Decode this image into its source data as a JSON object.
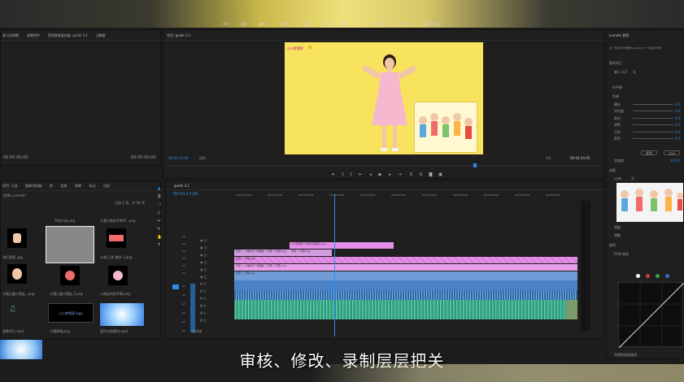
{
  "topbar": {
    "workspace_tabs": [
      "学习",
      "组件",
      "编辑",
      "颜色",
      "效果",
      "音频",
      "图形",
      "库",
      "Editing",
      "Effects",
      "使用工作区"
    ]
  },
  "source_panel": {
    "tabs": [
      "源:(无剪辑)",
      "效果控件",
      "音频剪辑混合器: guide 3.1",
      "元数据"
    ],
    "timecode_left": "00:00:00:00",
    "timecode_right": "00:00:00:00"
  },
  "program_panel": {
    "title": "节目: guide 3.1",
    "timecode": "00:03:17:06",
    "fit": "适合",
    "ratio": "1/2",
    "duration": "00:04:24:05"
  },
  "video_frame": {
    "logo_text": "小小梦想家"
  },
  "project_panel": {
    "tabs": [
      "项目: 己选",
      "媒体浏览器",
      "库",
      "信息",
      "效果",
      "标记",
      "历史"
    ],
    "search_label": "剪辑 ▸ Lumetri",
    "item_count": "已选 1 项，共 46 项",
    "items": [
      {
        "name": "流行背景 .jpg",
        "duration": ""
      },
      {
        "name": "手绘小孩.png",
        "duration": "5:00"
      },
      {
        "name": "卡通小朋友手牵手...png",
        "duration": "5:00"
      },
      {
        "name": "卡通 小孩 素材 1.png",
        "duration": "5:00"
      },
      {
        "name": "卡通儿童小朋友...png",
        "duration": "5:00"
      },
      {
        "name": "卡通儿童小朋友 2.png",
        "duration": "5:00"
      },
      {
        "name": "小朋友的拍手舞.png",
        "duration": "5:00"
      },
      {
        "name": "卡通手势剪影.png",
        "duration": "5:00"
      },
      {
        "name": "卡通表情.png",
        "duration": "5:00"
      },
      {
        "name": "背景声乐.mp3",
        "duration": ""
      },
      {
        "name": "小小梦想家 logo",
        "duration": ""
      },
      {
        "name": "蓝色光效素材.mp4",
        "duration": "5:00"
      }
    ]
  },
  "timeline": {
    "sequence_tab": "guide 3.1",
    "timecode": "00:03:17:06",
    "ruler_marks": [
      "00:03:12:02",
      "00:03:14:02",
      "00:03:16:02",
      "00:03:18:02",
      "00:03:20:02",
      "00:03:22:02",
      "00:03:24:02",
      "00:03:26:02",
      "00:03:28:02",
      "00:03:30:02",
      "00:03:32:02"
    ],
    "tracks": [
      "V6",
      "V5",
      "V4",
      "V3",
      "V2",
      "V1",
      "A1",
      "A2",
      "A3",
      "A4",
      "A5",
      "A6"
    ],
    "clips": [
      {
        "label": "小小梦想家丨同学们来配合.png"
      },
      {
        "label": "字幕 丨 小朋友们一起跳舞 丨字幕 丨字幕.png"
      },
      {
        "label": "字幕 丨 字幕.png"
      },
      {
        "label": "字幕 丨 字幕.png"
      },
      {
        "label": "字幕 丨 小朋友们一起跳舞 丨字幕 丨字幕.png"
      },
      {
        "label": "字幕 丨 字幕.png"
      }
    ],
    "master_label": "主声道"
  },
  "lumetri": {
    "tab": "Lumetri 颜色",
    "source_label": "主 * 手拉手卡通素材 ▸ guide 3.1 * 手拉手卡通",
    "section_basic": "基本校正",
    "input_lut_label": "输入 LUT",
    "input_lut_value": "无",
    "white_balance": "白平衡",
    "tone": "色调",
    "sliders": [
      {
        "label": "曝光",
        "value": "0.0"
      },
      {
        "label": "对比度",
        "value": "0.0"
      },
      {
        "label": "高光",
        "value": "0.0"
      },
      {
        "label": "阴影",
        "value": "0.0"
      },
      {
        "label": "白色",
        "value": "0.0"
      },
      {
        "label": "黑色",
        "value": "0.0"
      }
    ],
    "reset": "重置",
    "auto": "自动",
    "saturation_label": "饱和度",
    "saturation_value": "100.0",
    "creative": "创意",
    "look_label": "Look",
    "look_value": "无",
    "intensity": "强度",
    "adjust": "调整",
    "curves": "曲线",
    "rgb_curves": "RGB 曲线",
    "hue_sat": "色相饱和度曲线"
  },
  "subtitle_text": "审核、修改、录制层层把关",
  "colors": {
    "accent_blue": "#2d8ceb",
    "clip_pink": "#e58fe8",
    "clip_video": "#d29ce0",
    "audio_green": "#3ba88a",
    "audio_blue": "#4a82c8",
    "video_bg": "#f7e35d"
  }
}
